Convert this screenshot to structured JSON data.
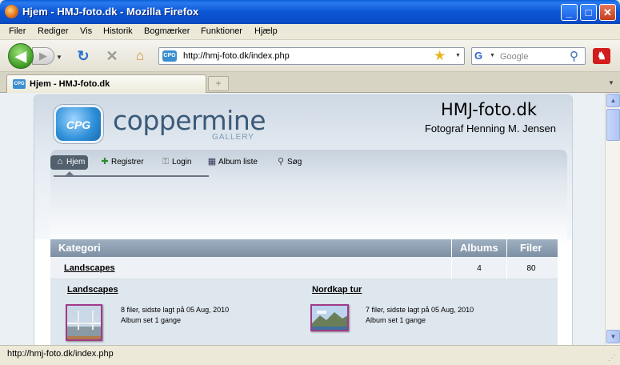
{
  "window": {
    "title": "Hjem - HMJ-foto.dk - Mozilla Firefox",
    "minimize": "_",
    "maximize": "□",
    "close": "✕"
  },
  "menu": [
    "Filer",
    "Rediger",
    "Vis",
    "Historik",
    "Bogmærker",
    "Funktioner",
    "Hjælp"
  ],
  "toolbar": {
    "url": "http://hmj-foto.dk/index.php",
    "search_placeholder": "Google",
    "site_icon": "CPG"
  },
  "tab": {
    "label": "Hjem - HMJ-foto.dk"
  },
  "page": {
    "logo_text": "CPG",
    "brand": "coppermine",
    "brand_sub": "GALLERY",
    "site_title": "HMJ-foto.dk",
    "site_subtitle": "Fotograf Henning M. Jensen",
    "nav": [
      {
        "label": "Hjem",
        "icon": "home-icon"
      },
      {
        "label": "Registrer",
        "icon": "add-user-icon"
      },
      {
        "label": "Login",
        "icon": "key-icon"
      },
      {
        "label": "Album liste",
        "icon": "album-list-icon"
      },
      {
        "label": "Søg",
        "icon": "search-icon"
      }
    ],
    "table": {
      "headers": [
        "Kategori",
        "Albums",
        "Filer"
      ],
      "row": {
        "name": "Landscapes",
        "albums": "4",
        "files": "80"
      }
    },
    "albums": [
      {
        "title": "Landscapes",
        "line1": "8 filer, sidste lagt på 05 Aug, 2010",
        "line2": "Album set 1 gange"
      },
      {
        "title": "Nordkap tur",
        "line1": "7 filer, sidste lagt på 05 Aug, 2010",
        "line2": "Album set 1 gange"
      }
    ]
  },
  "status": {
    "text": "http://hmj-foto.dk/index.php"
  },
  "colors": {
    "titlebar": "#0b55d4",
    "table_header": "#8a9bb0",
    "brand": "#3b5a78"
  }
}
